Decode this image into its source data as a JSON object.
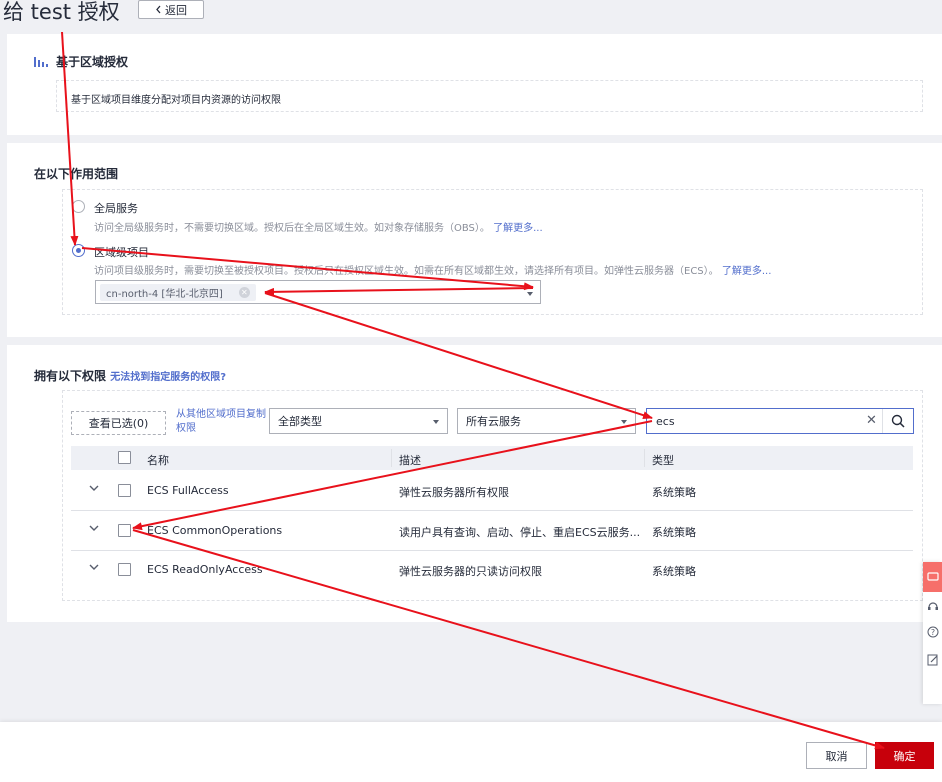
{
  "page": {
    "title": "给 test 授权",
    "back_label": "返回"
  },
  "policy_card": {
    "name": "基于区域授权",
    "description": "基于区域项目维度分配对项目内资源的访问权限"
  },
  "scope": {
    "title": "在以下作用范围",
    "global": {
      "label": "全局服务",
      "desc": "访问全局级服务时，不需要切换区域。授权后在全局区域生效。如对象存储服务（OBS）。",
      "link": "了解更多..."
    },
    "region": {
      "label": "区域级项目",
      "desc": "访问项目级服务时，需要切换至被授权项目。授权后只在授权区域生效。如需在所有区域都生效，请选择所有项目。如弹性云服务器（ECS）。",
      "link": "了解更多...",
      "selected_tag": "cn-north-4 [华北-北京四]"
    }
  },
  "permissions": {
    "title": "拥有以下权限",
    "help_link": "无法找到指定服务的权限?",
    "view_selected": "查看已选(0)",
    "copy_link": "从其他区域项目复制权限",
    "type_filter": "全部类型",
    "service_filter": "所有云服务",
    "search_value": "ecs",
    "columns": {
      "name": "名称",
      "desc": "描述",
      "type": "类型"
    },
    "rows": [
      {
        "name": "ECS FullAccess",
        "desc": "弹性云服务器所有权限",
        "type": "系统策略"
      },
      {
        "name": "ECS CommonOperations",
        "desc": "读用户具有查询、启动、停止、重启ECS云服务...",
        "type": "系统策略"
      },
      {
        "name": "ECS ReadOnlyAccess",
        "desc": "弹性云服务器的只读访问权限",
        "type": "系统策略"
      }
    ]
  },
  "footer": {
    "cancel": "取消",
    "confirm": "确定"
  },
  "colors": {
    "accent": "#526ecc",
    "primary_button": "#c7000b",
    "annotation_arrow": "#e8111b"
  }
}
